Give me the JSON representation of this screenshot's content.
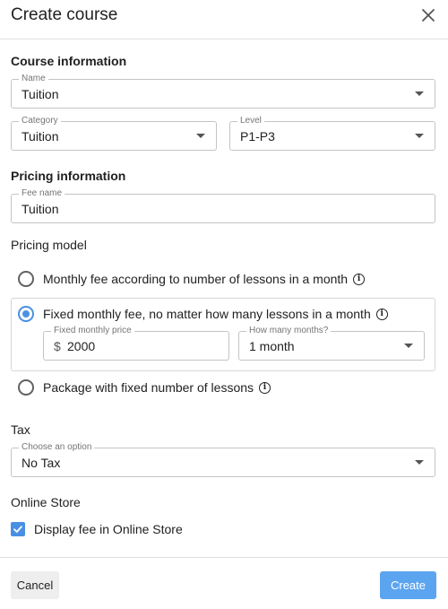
{
  "dialog": {
    "title": "Create course"
  },
  "course_info": {
    "heading": "Course information",
    "name": {
      "legend": "Name",
      "value": "Tuition"
    },
    "category": {
      "legend": "Category",
      "value": "Tuition"
    },
    "level": {
      "legend": "Level",
      "value": "P1-P3"
    }
  },
  "pricing_info": {
    "heading": "Pricing information",
    "fee_name": {
      "legend": "Fee name",
      "value": "Tuition"
    }
  },
  "pricing_model": {
    "label": "Pricing model",
    "options": [
      {
        "label": "Monthly fee according to number of lessons in a month",
        "checked": false
      },
      {
        "label": "Fixed monthly fee, no matter how many lessons in a month",
        "checked": true
      },
      {
        "label": "Package with fixed number of lessons",
        "checked": false
      }
    ],
    "fixed_monthly_price": {
      "legend": "Fixed monthly price",
      "currency": "$",
      "value": "2000"
    },
    "how_many_months": {
      "legend": "How many months?",
      "value": "1 month"
    }
  },
  "tax": {
    "label": "Tax",
    "select": {
      "legend": "Choose an option",
      "value": "No Tax"
    }
  },
  "online_store": {
    "label": "Online Store",
    "display_fee": {
      "label": "Display fee in Online Store",
      "checked": true
    }
  },
  "footer": {
    "cancel_label": "Cancel",
    "create_label": "Create"
  },
  "colors": {
    "accent": "#4a90e2",
    "create_button": "#5ba4f0"
  }
}
